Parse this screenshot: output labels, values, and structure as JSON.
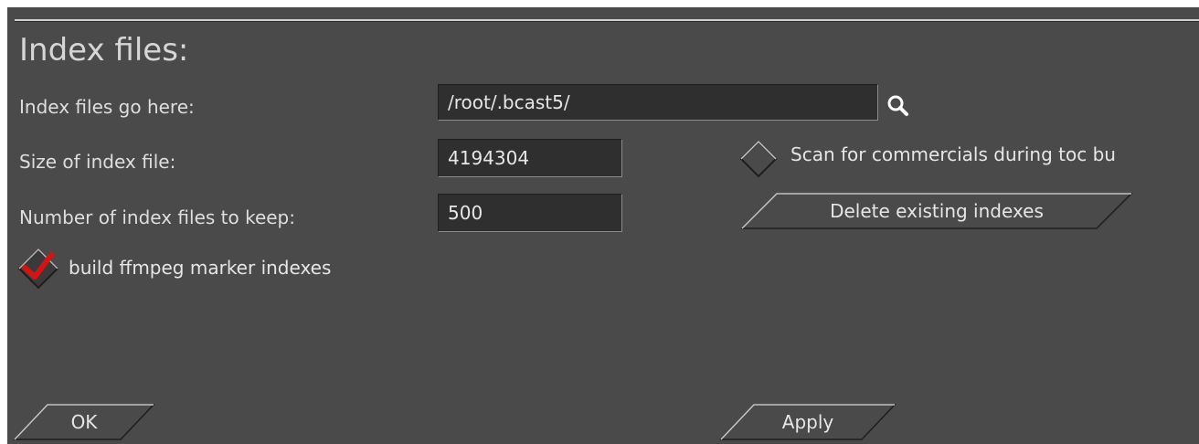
{
  "section_title": "Index files:",
  "index_dir": {
    "label": "Index files go here:",
    "value": "/root/.bcast5/"
  },
  "index_size": {
    "label": "Size of index file:",
    "value": "4194304"
  },
  "index_count": {
    "label": "Number of index files to keep:",
    "value": "500"
  },
  "scan_commercials": {
    "label": "Scan for commercials during toc bu",
    "checked": false
  },
  "delete_indexes_label": "Delete existing indexes",
  "ffmpeg_markers": {
    "label": "build ffmpeg marker indexes",
    "checked": true
  },
  "buttons": {
    "ok_label": "OK",
    "apply_label": "Apply"
  },
  "icons": {
    "search": "magnifier-icon",
    "checkbox_checked": "red-checkmark-icon",
    "checkbox_unchecked": "diamond-checkbox-icon"
  },
  "colors": {
    "background": "#4a4a4a",
    "check_accent": "#d41414"
  }
}
